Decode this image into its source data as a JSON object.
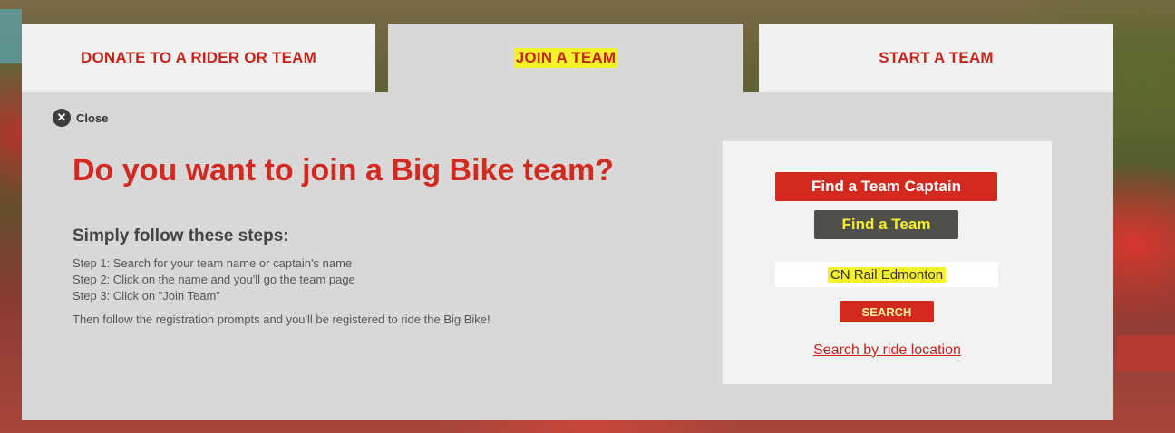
{
  "tabs": [
    {
      "label": "DONATE TO A RIDER OR TEAM"
    },
    {
      "label": "JOIN A TEAM"
    },
    {
      "label": "START A TEAM"
    }
  ],
  "panel": {
    "close_label": "Close",
    "title": "Do you want to join a Big Bike team?",
    "subtitle": "Simply follow these steps:",
    "steps": [
      "Step 1: Search for your team name or captain's name",
      "Step 2: Click on the name and you'll go the team page",
      "Step 3: Click on \"Join Team\""
    ],
    "then_text": "Then follow the registration prompts and you'll be registered to ride the Big Bike!"
  },
  "search": {
    "find_captain_label": "Find a Team Captain",
    "find_team_label": "Find a Team",
    "query_value": "CN Rail Edmonton",
    "search_button_label": "SEARCH",
    "location_link": "Search by ride location"
  },
  "icons": {
    "close": "close-icon"
  },
  "colors": {
    "brand_red": "#d22a20",
    "panel_gray": "#d9d8d8",
    "highlight_yellow": "#f6f12b",
    "dark_button": "#4f504a"
  }
}
